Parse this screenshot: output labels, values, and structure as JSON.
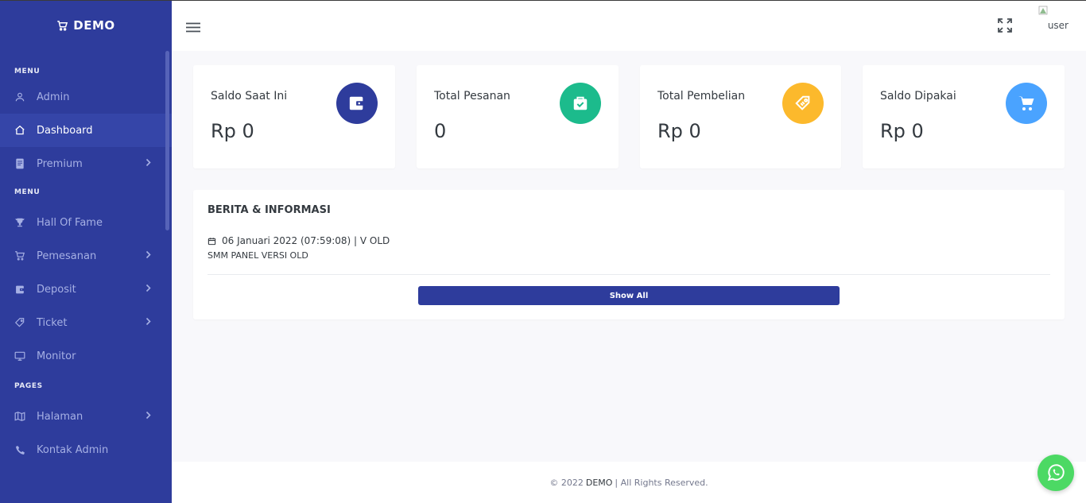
{
  "brand": {
    "name": "DEMO",
    "icon": "cart-icon"
  },
  "sidebar": {
    "sections": [
      {
        "title": "MENU",
        "items": [
          {
            "label": "Admin",
            "icon": "user-icon",
            "submenu": false,
            "active": false
          },
          {
            "label": "Dashboard",
            "icon": "home-icon",
            "submenu": false,
            "active": true
          },
          {
            "label": "Premium",
            "icon": "document-icon",
            "submenu": true,
            "active": false
          }
        ]
      },
      {
        "title": "MENU",
        "items": [
          {
            "label": "Hall Of Fame",
            "icon": "trophy-icon",
            "submenu": false,
            "active": false
          },
          {
            "label": "Pemesanan",
            "icon": "cart-icon",
            "submenu": true,
            "active": false
          },
          {
            "label": "Deposit",
            "icon": "wallet-icon",
            "submenu": true,
            "active": false
          },
          {
            "label": "Ticket",
            "icon": "tag-icon",
            "submenu": true,
            "active": false
          },
          {
            "label": "Monitor",
            "icon": "monitor-icon",
            "submenu": false,
            "active": false
          }
        ]
      },
      {
        "title": "PAGES",
        "items": [
          {
            "label": "Halaman",
            "icon": "map-icon",
            "submenu": true,
            "active": false
          },
          {
            "label": "Kontak Admin",
            "icon": "phone-icon",
            "submenu": false,
            "active": false
          }
        ]
      }
    ]
  },
  "topbar": {
    "user_label": "user",
    "user_alt": "user"
  },
  "stats": [
    {
      "label": "Saldo Saat Ini",
      "value": "Rp 0",
      "icon": "wallet-icon",
      "color": "#2e3c9c"
    },
    {
      "label": "Total Pesanan",
      "value": "0",
      "icon": "briefcase-check-icon",
      "color": "#1cbb8c"
    },
    {
      "label": "Total Pembelian",
      "value": "Rp 0",
      "icon": "tag-icon",
      "color": "#fcb92c"
    },
    {
      "label": "Saldo Dipakai",
      "value": "Rp 0",
      "icon": "cart-icon",
      "color": "#4aa3ff"
    }
  ],
  "news": {
    "title": "BERITA & INFORMASI",
    "date": "06 Januari 2022 (07:59:08) | V OLD",
    "body": "SMM PANEL VERSI OLD",
    "button": "Show All"
  },
  "footer": {
    "prefix": "© 2022",
    "brand": "DEMO",
    "suffix": "| All Rights Reserved."
  },
  "colors": {
    "sidebar": "#2e3c9c",
    "whatsapp": "#4cd964"
  }
}
